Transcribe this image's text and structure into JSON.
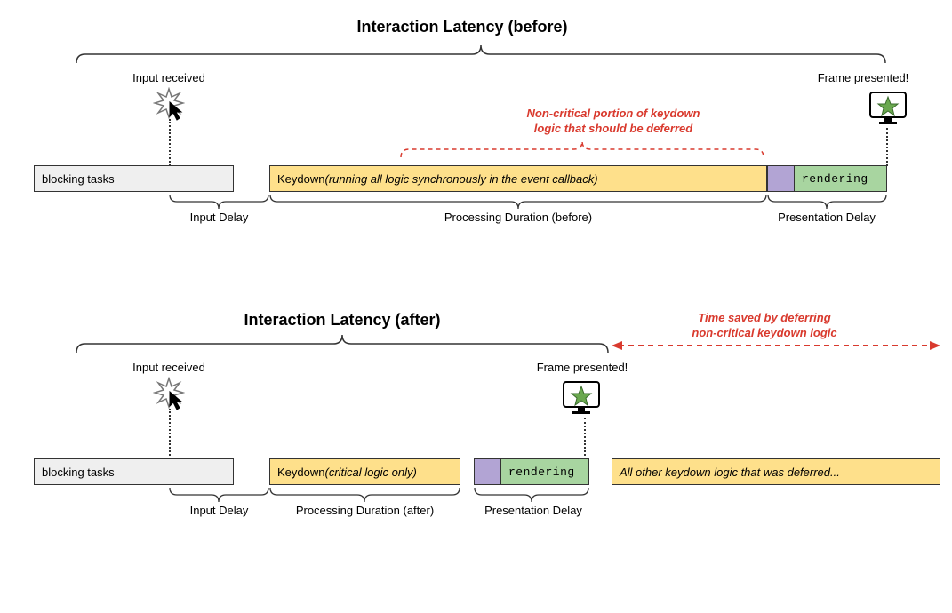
{
  "before": {
    "title": "Interaction Latency (before)",
    "input_received": "Input received",
    "frame_presented": "Frame presented!",
    "red_note_line1": "Non-critical portion of keydown",
    "red_note_line2": "logic that should be deferred",
    "blocks": {
      "blocking": "blocking tasks",
      "keydown_prefix": "Keydown ",
      "keydown_detail": "(running all logic synchronously in the event callback)",
      "rendering": "rendering"
    },
    "sublabels": {
      "input_delay": "Input Delay",
      "processing": "Processing Duration (before)",
      "presentation": "Presentation Delay"
    }
  },
  "after": {
    "title": "Interaction Latency (after)",
    "input_received": "Input received",
    "frame_presented": "Frame presented!",
    "red_note_line1": "Time saved by deferring",
    "red_note_line2": "non-critical keydown logic",
    "blocks": {
      "blocking": "blocking tasks",
      "keydown_prefix": "Keydown ",
      "keydown_detail": "(critical logic only)",
      "rendering": "rendering",
      "deferred": "All other keydown logic that was deferred..."
    },
    "sublabels": {
      "input_delay": "Input Delay",
      "processing": "Processing Duration (after)",
      "presentation": "Presentation Delay"
    }
  },
  "chart_data": {
    "type": "table",
    "description": "Two timeline diagrams comparing interaction latency before and after deferring non-critical keydown logic.",
    "before": {
      "phases": [
        {
          "name": "blocking tasks",
          "relative_width": 225
        },
        {
          "name": "gap",
          "relative_width": 40
        },
        {
          "name": "Keydown (all logic synchronous)",
          "relative_width": 560
        },
        {
          "name": "purple pre-render",
          "relative_width": 30
        },
        {
          "name": "rendering",
          "relative_width": 105
        }
      ],
      "brackets": [
        {
          "name": "Input Delay",
          "from": "end of input-received marker",
          "to": "start of Keydown"
        },
        {
          "name": "Processing Duration (before)",
          "span": "Keydown block"
        },
        {
          "name": "Presentation Delay",
          "span": "purple + rendering"
        }
      ],
      "annotation": "Non-critical portion of keydown logic (right-half of Keydown block) should be deferred"
    },
    "after": {
      "phases": [
        {
          "name": "blocking tasks",
          "relative_width": 225
        },
        {
          "name": "gap",
          "relative_width": 40
        },
        {
          "name": "Keydown (critical only)",
          "relative_width": 215
        },
        {
          "name": "gap",
          "relative_width": 15
        },
        {
          "name": "purple pre-render",
          "relative_width": 30
        },
        {
          "name": "rendering",
          "relative_width": 100
        },
        {
          "name": "gap",
          "relative_width": 25
        },
        {
          "name": "deferred logic",
          "relative_width": 370
        }
      ],
      "brackets": [
        {
          "name": "Input Delay",
          "from": "end of input-received marker",
          "to": "start of Keydown"
        },
        {
          "name": "Processing Duration (after)",
          "span": "Keydown block"
        },
        {
          "name": "Presentation Delay",
          "span": "purple + rendering"
        }
      ],
      "annotation": "Time saved by deferring non-critical keydown logic = span from new frame-presented to old frame-presented"
    }
  }
}
